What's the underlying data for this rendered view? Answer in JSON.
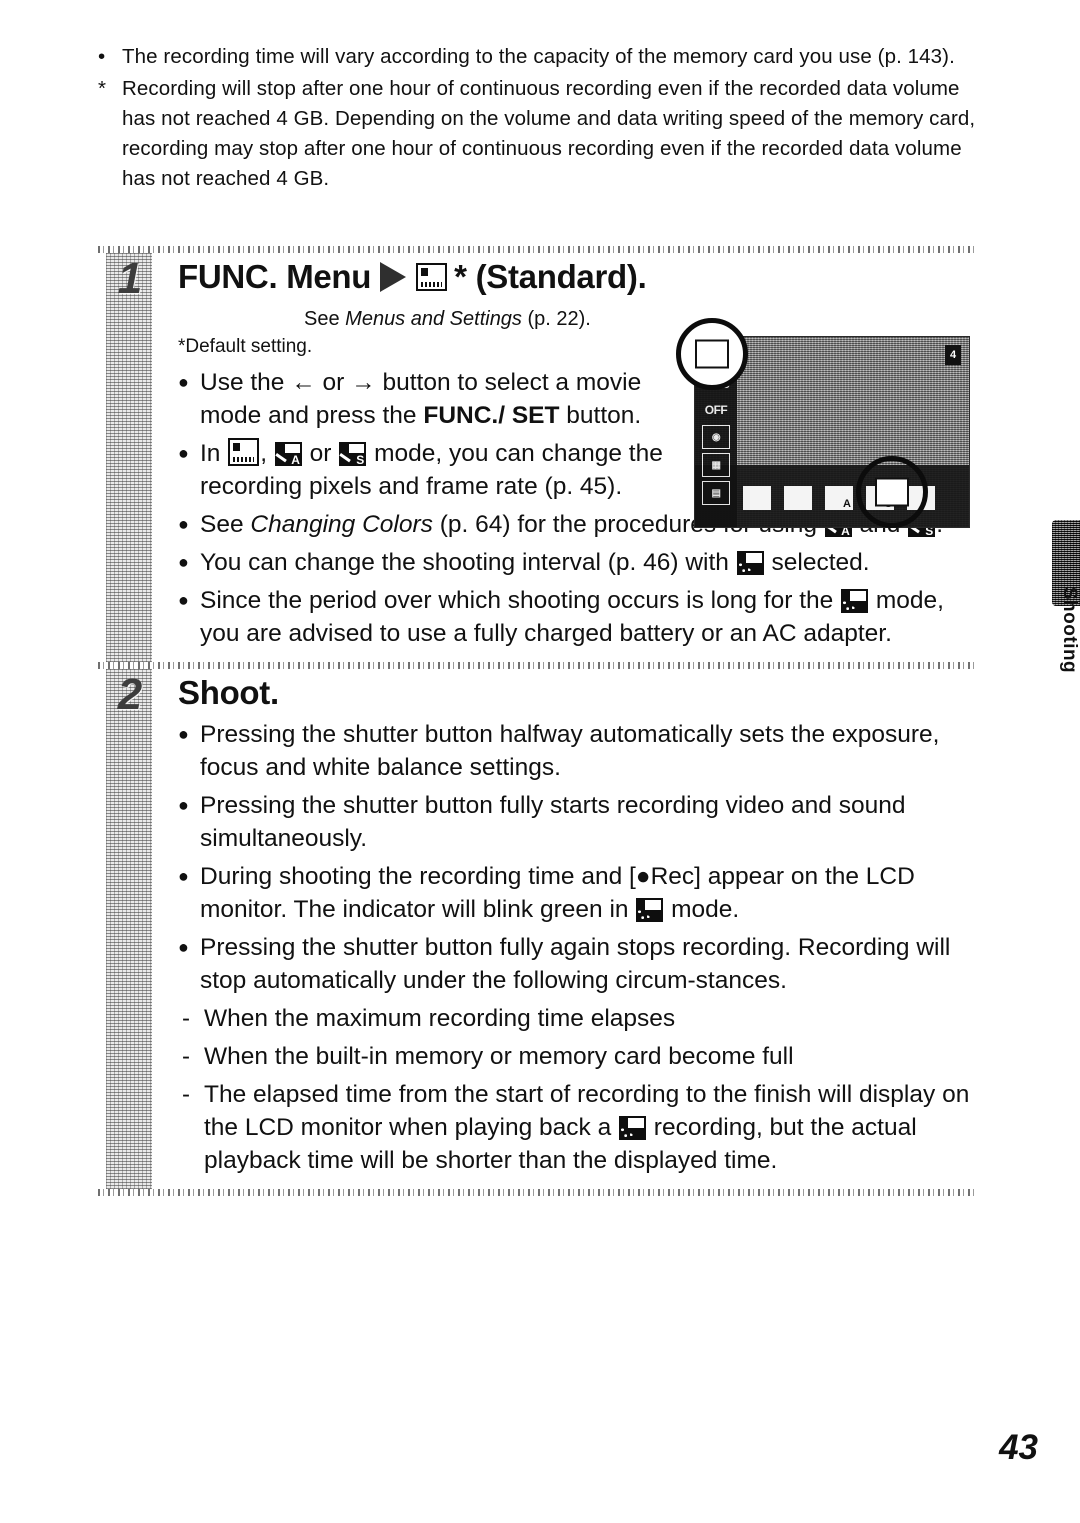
{
  "page": {
    "number": "43",
    "thumb_tab_label": "Shooting"
  },
  "notes": [
    {
      "marker": "•",
      "text": "The recording time will vary according to the capacity of the memory card you use (p. 143)."
    },
    {
      "marker": "*",
      "text": "Recording will stop after one hour of continuous recording even if the recorded data volume has not reached 4 GB. Depending on the volume and data writing speed of the memory card, recording may stop after one hour of continuous recording even if the recorded data volume has not reached 4 GB."
    }
  ],
  "steps": [
    {
      "number": "1",
      "heading_prefix": "FUNC. Menu",
      "heading_suffix": "* (Standard).",
      "see_line_prefix": "See ",
      "see_line_italic": "Menus and Settings",
      "see_line_suffix": " (p. 22).",
      "default_note": "*Default setting.",
      "bullets": [
        {
          "parts": [
            {
              "type": "text",
              "value": "Use the "
            },
            {
              "type": "glyph",
              "value": "←"
            },
            {
              "type": "text",
              "value": " or "
            },
            {
              "type": "glyph",
              "value": "→"
            },
            {
              "type": "text",
              "value": " button to select a movie mode and press the "
            },
            {
              "type": "bold",
              "value": "FUNC./ SET"
            },
            {
              "type": "text",
              "value": " button."
            }
          ]
        },
        {
          "parts": [
            {
              "type": "text",
              "value": "In "
            },
            {
              "type": "icon",
              "value": "standard-movie-icon"
            },
            {
              "type": "text",
              "value": ", "
            },
            {
              "type": "icon",
              "value": "color-accent-icon"
            },
            {
              "type": "text",
              "value": " or "
            },
            {
              "type": "icon",
              "value": "color-swap-icon"
            },
            {
              "type": "text",
              "value": " mode, you can change the recording pixels and frame rate (p. 45)."
            }
          ]
        },
        {
          "parts": [
            {
              "type": "text",
              "value": "See "
            },
            {
              "type": "italic",
              "value": "Changing Colors"
            },
            {
              "type": "text",
              "value": " (p. 64) for the procedures for using "
            },
            {
              "type": "icon",
              "value": "color-accent-icon"
            },
            {
              "type": "text",
              "value": " and "
            },
            {
              "type": "icon",
              "value": "color-swap-icon"
            },
            {
              "type": "text",
              "value": "."
            }
          ]
        },
        {
          "parts": [
            {
              "type": "text",
              "value": "You can change the shooting interval (p. 46) with "
            },
            {
              "type": "icon",
              "value": "time-lapse-icon"
            },
            {
              "type": "text",
              "value": " selected."
            }
          ]
        },
        {
          "parts": [
            {
              "type": "text",
              "value": "Since the period over which shooting occurs is long for the "
            },
            {
              "type": "icon",
              "value": "time-lapse-icon"
            },
            {
              "type": "text",
              "value": " mode, you are advised to use a fully charged battery or an AC adapter."
            }
          ]
        }
      ]
    },
    {
      "number": "2",
      "heading_prefix": "Shoot.",
      "bullets": [
        {
          "parts": [
            {
              "type": "text",
              "value": "Pressing the shutter button halfway automatically sets the exposure, focus and white balance settings."
            }
          ]
        },
        {
          "parts": [
            {
              "type": "text",
              "value": "Pressing the shutter button fully starts recording video and sound simultaneously."
            }
          ]
        },
        {
          "parts": [
            {
              "type": "text",
              "value": "During shooting the recording time and [●Rec] appear on the LCD monitor. The indicator will blink green in "
            },
            {
              "type": "icon",
              "value": "time-lapse-icon"
            },
            {
              "type": "text",
              "value": " mode."
            }
          ]
        },
        {
          "parts": [
            {
              "type": "text",
              "value": "Pressing the shutter button fully again stops recording. Recording will stop automatically under the following circum-stances."
            }
          ]
        }
      ],
      "sub_bullets": [
        {
          "parts": [
            {
              "type": "text",
              "value": "When the maximum recording time elapses"
            }
          ]
        },
        {
          "parts": [
            {
              "type": "text",
              "value": "When the built-in memory or memory card become full"
            }
          ]
        },
        {
          "parts": [
            {
              "type": "text",
              "value": "The elapsed time from the start of recording to the finish will display on the LCD monitor when playing back a "
            },
            {
              "type": "icon",
              "value": "time-lapse-icon"
            },
            {
              "type": "text",
              "value": " recording, but the actual playback time will be shorter than the displayed time."
            }
          ]
        }
      ]
    }
  ],
  "lcd_screen": {
    "left_icons": [
      "AWB",
      "OFF",
      "ISO-auto",
      "quality",
      "size"
    ],
    "bottom_modes": [
      "standard",
      "compact",
      "color-accent",
      "color-swap",
      "time-lapse"
    ],
    "battery_indicator": "4",
    "highlight_top_left": "selected-menu-item",
    "highlight_bottom": "selected-movie-mode"
  },
  "icons": {
    "arrow-left": "←",
    "arrow-right": "→",
    "triangle-right": "▶",
    "standard-movie-icon": "standard",
    "color-accent-icon": "A",
    "color-swap-icon": "S",
    "time-lapse-icon": "time-lapse"
  },
  "colors": {
    "ink": "#111111",
    "texture_light": "#e9e9e9",
    "texture_dark": "#4a4a4a",
    "paper": "#ffffff"
  }
}
